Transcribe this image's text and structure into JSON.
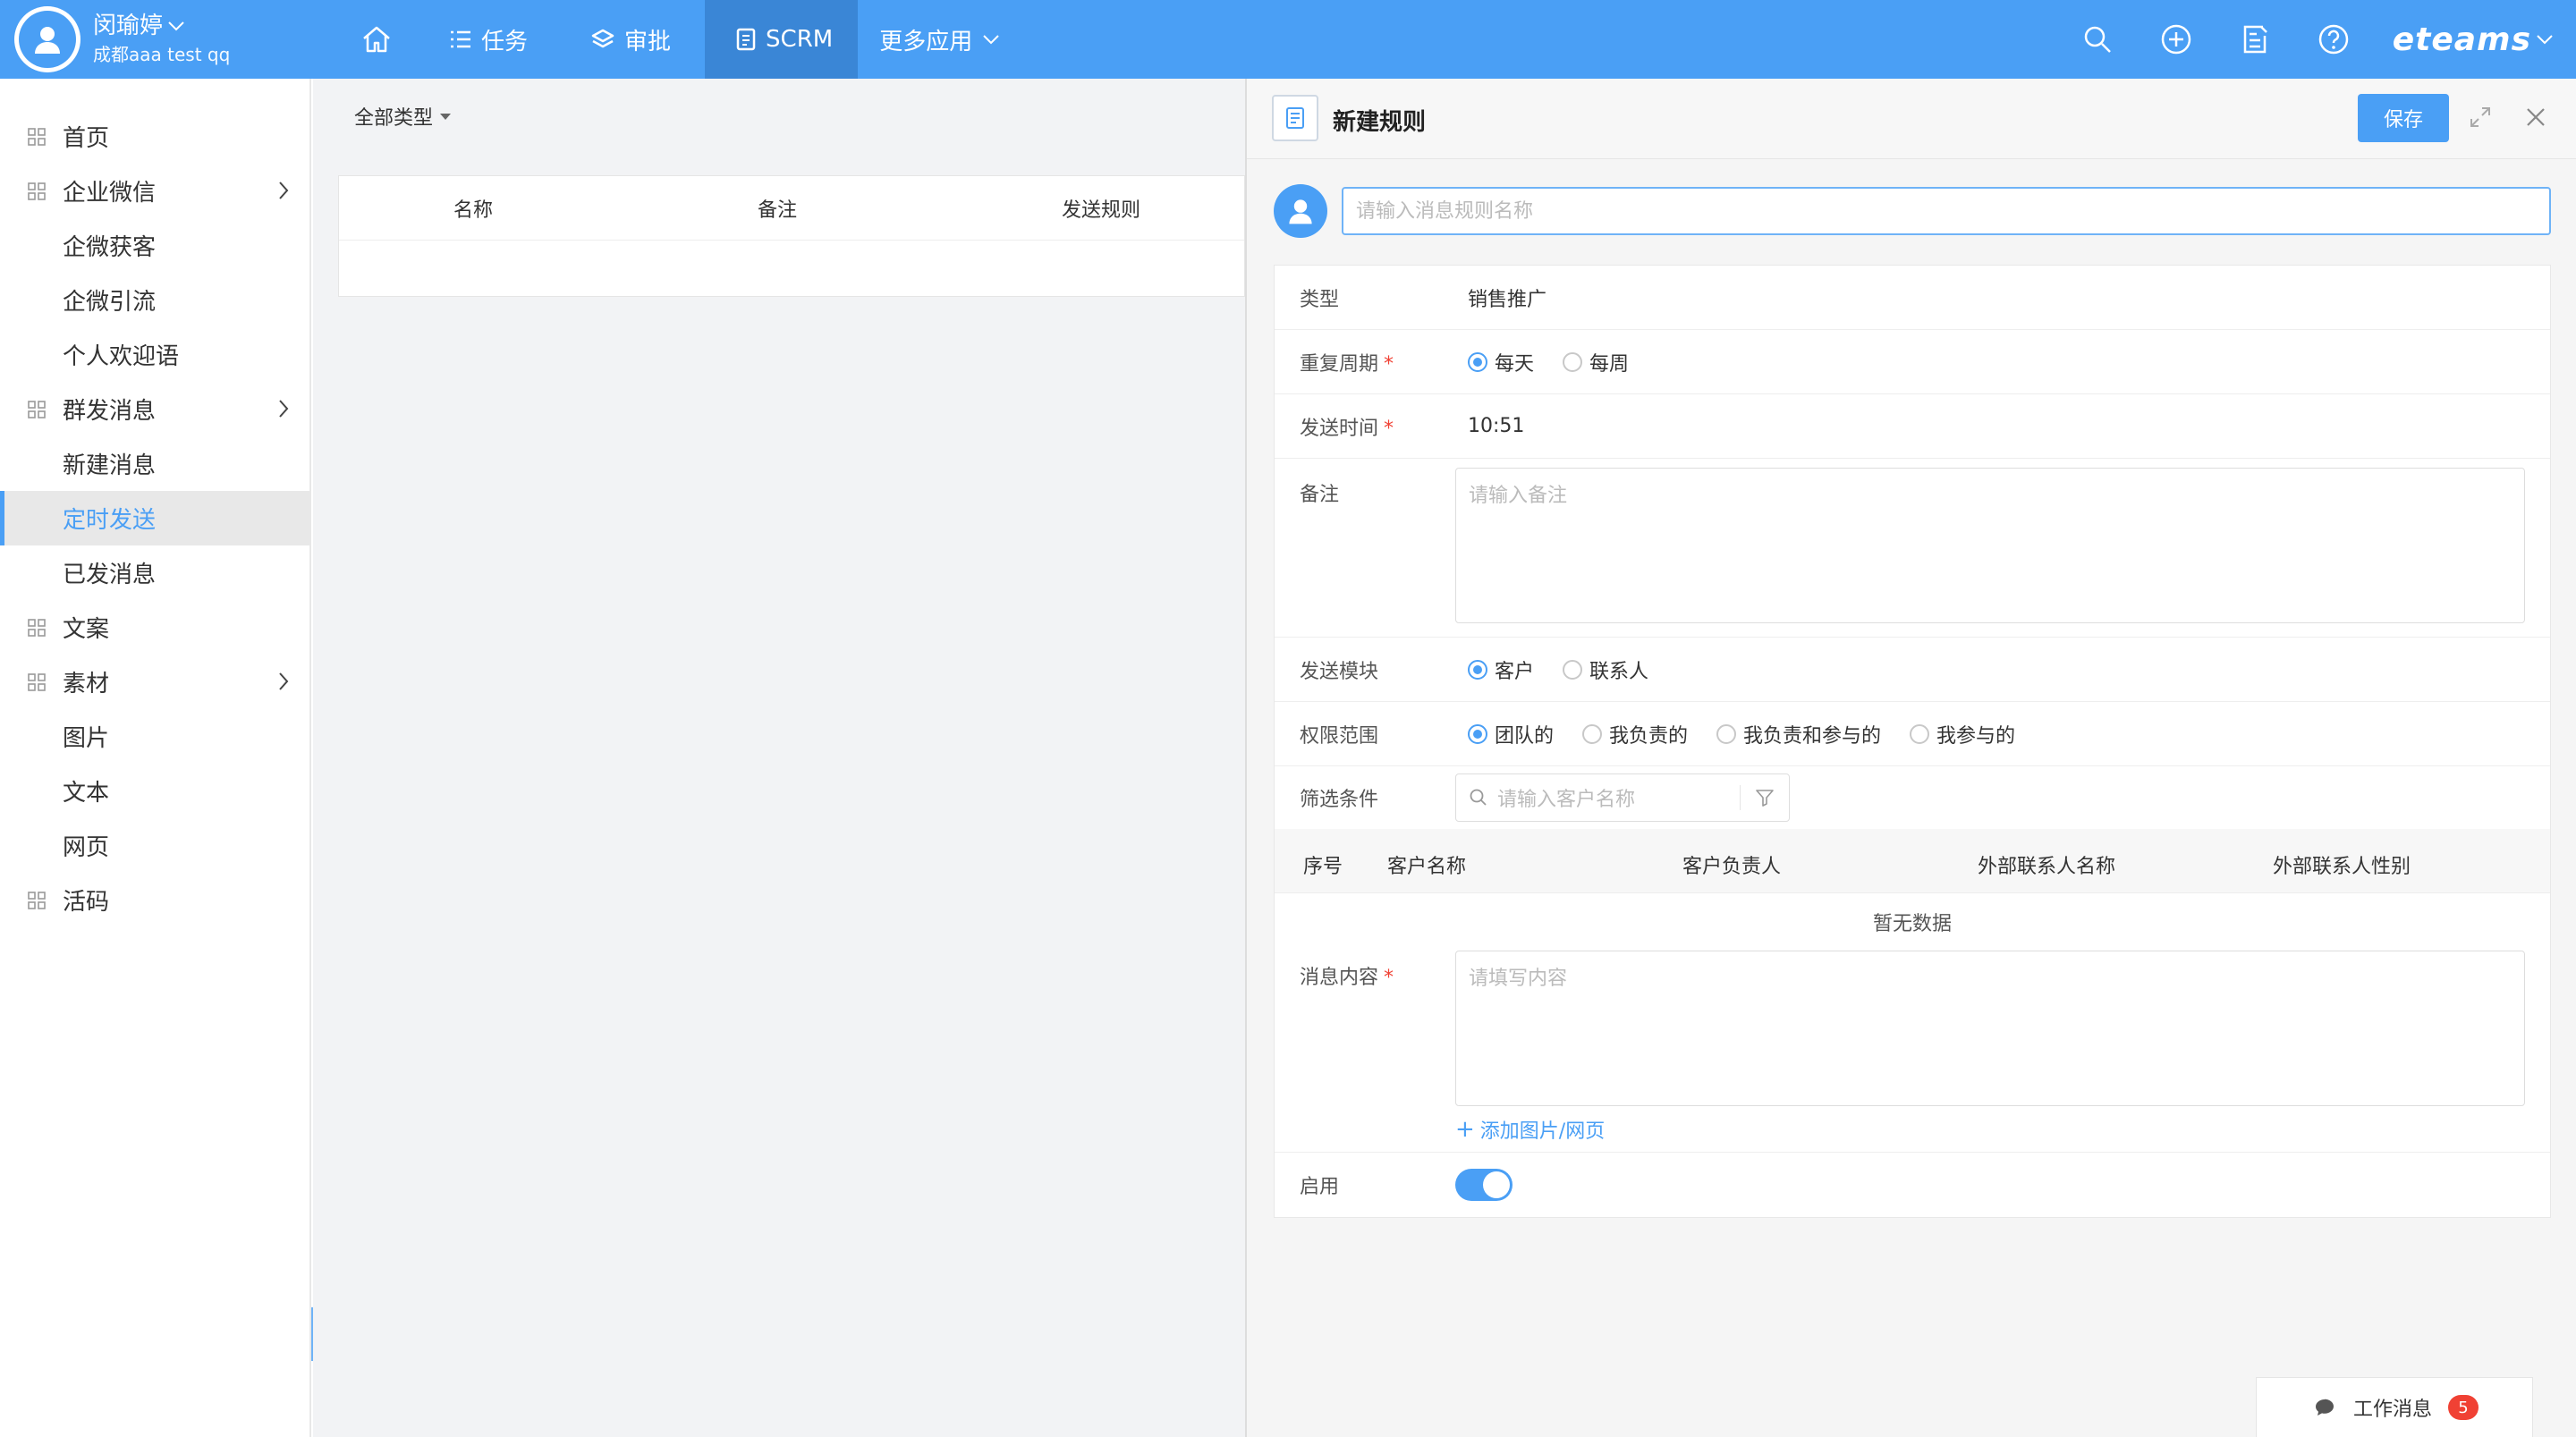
{
  "user": {
    "name": "闵瑜婷",
    "org": "成都aaa test qq"
  },
  "nav": {
    "items": [
      {
        "label": ""
      },
      {
        "label": "任务"
      },
      {
        "label": "审批"
      },
      {
        "label": "SCRM"
      },
      {
        "label": "更多应用"
      }
    ]
  },
  "brand": "eteams",
  "sidebar": {
    "items": [
      {
        "label": "首页"
      },
      {
        "label": "企业微信"
      },
      {
        "label": "企微获客"
      },
      {
        "label": "企微引流"
      },
      {
        "label": "个人欢迎语"
      },
      {
        "label": "群发消息"
      },
      {
        "label": "新建消息"
      },
      {
        "label": "定时发送"
      },
      {
        "label": "已发消息"
      },
      {
        "label": "文案"
      },
      {
        "label": "素材"
      },
      {
        "label": "图片"
      },
      {
        "label": "文本"
      },
      {
        "label": "网页"
      },
      {
        "label": "活码"
      }
    ]
  },
  "list": {
    "filter": "全部类型",
    "columns": [
      "名称",
      "备注",
      "发送规则"
    ]
  },
  "panel": {
    "title": "新建规则",
    "save": "保存",
    "name_placeholder": "请输入消息规则名称",
    "type_label": "类型",
    "type_value": "销售推广",
    "repeat_label": "重复周期",
    "repeat_options": [
      "每天",
      "每周"
    ],
    "time_label": "发送时间",
    "time_value": "10:51",
    "remark_label": "备注",
    "remark_placeholder": "请输入备注",
    "module_label": "发送模块",
    "module_options": [
      "客户",
      "联系人"
    ],
    "scope_label": "权限范围",
    "scope_options": [
      "团队的",
      "我负责的",
      "我负责和参与的",
      "我参与的"
    ],
    "filter_label": "筛选条件",
    "filter_placeholder": "请输入客户名称",
    "table_columns": [
      "序号",
      "客户名称",
      "客户负责人",
      "外部联系人名称",
      "外部联系人性别"
    ],
    "empty_text": "暂无数据",
    "content_label": "消息内容",
    "content_placeholder": "请填写内容",
    "add_link": "添加图片/网页",
    "enable_label": "启用",
    "required_mark": "*"
  },
  "work_msg": {
    "label": "工作消息",
    "count": "5"
  },
  "colors": {
    "primary": "#4a9ff5",
    "danger": "#f04134"
  }
}
